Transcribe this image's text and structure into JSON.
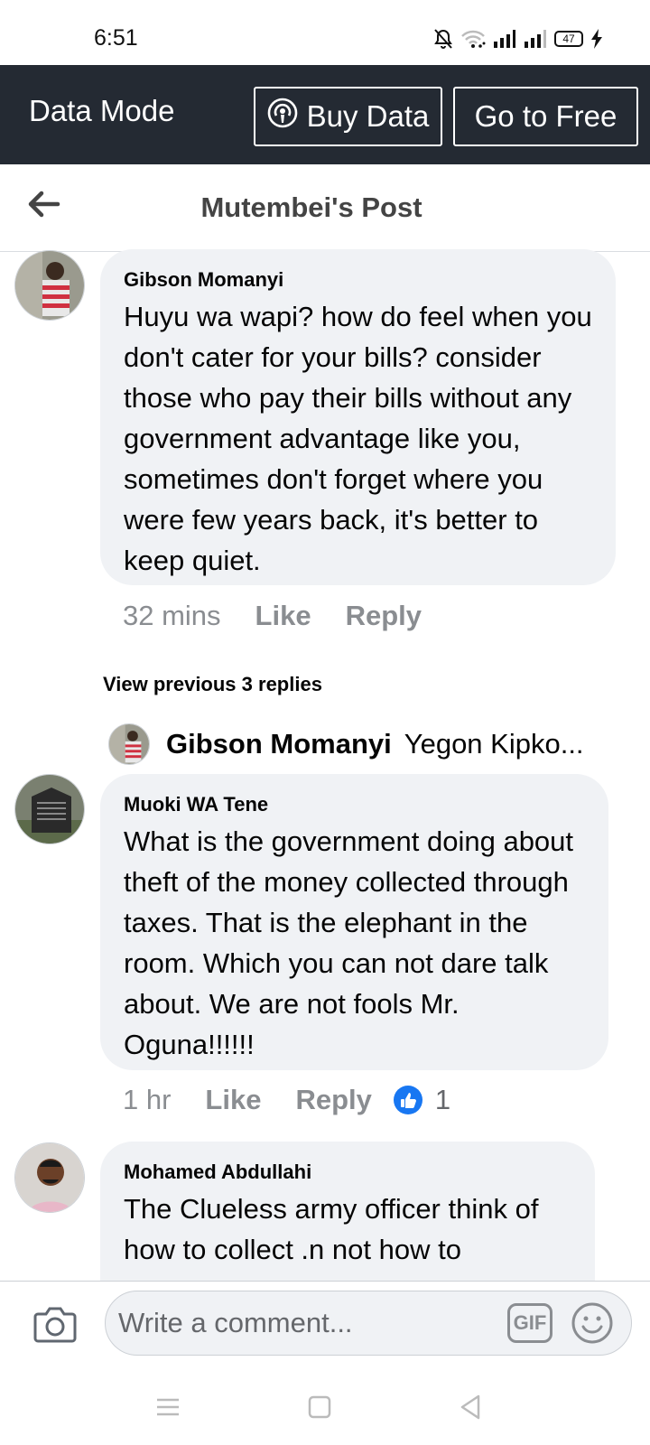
{
  "status_bar": {
    "time": "6:51",
    "battery": "47",
    "icons": [
      "bell-off-icon",
      "wifi-icon",
      "signal-icon",
      "signal-icon",
      "battery-icon",
      "charging-icon"
    ]
  },
  "data_bar": {
    "label": "Data Mode",
    "buy_data": "Buy Data",
    "go_free": "Go to Free",
    "background": "#242a33"
  },
  "header": {
    "title": "Mutembei's Post"
  },
  "comments": [
    {
      "author": "Gibson Momanyi",
      "text": "Huyu wa wapi? how do feel when you don't cater for your bills? consider those who pay their bills without any government advantage like you, sometimes don't forget where you were few years back, it's better to keep quiet.",
      "time": "32 mins",
      "like": "Like",
      "reply": "Reply"
    },
    {
      "author": "Muoki WA Tene",
      "text": "What is the government doing about theft of the money collected through taxes. That is the elephant in the room. Which you can not dare talk about. We are not fools Mr. Oguna!!!!!!",
      "time": "1 hr",
      "like": "Like",
      "reply": "Reply",
      "reactions": "1"
    },
    {
      "author": "Mohamed Abdullahi",
      "text": "The Clueless army officer think of how to collect .n not how  to"
    }
  ],
  "replies": {
    "view_previous": "View previous 3 replies",
    "preview_name": "Gibson Momanyi",
    "preview_snippet": "Yegon Kipko..."
  },
  "composer": {
    "placeholder": "Write a comment...",
    "gif": "GIF"
  },
  "colors": {
    "bubble": "#f0f2f5",
    "like_blue": "#1877f2",
    "muted": "#8a8d91"
  }
}
